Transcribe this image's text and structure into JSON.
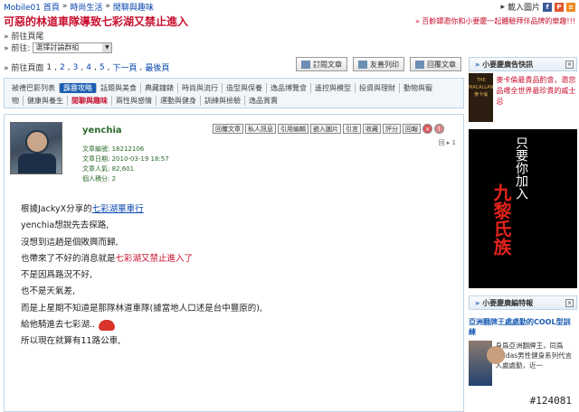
{
  "breadcrumb": [
    "Mobile01 首頁",
    "時尚生活",
    "閒聊與趣味"
  ],
  "breadcrumb_sep": "»",
  "top_right": {
    "label": "載入圖片",
    "arrow": "▸",
    "icons": [
      {
        "name": "facebook-icon",
        "glyph": "f",
        "color": "#3b5998"
      },
      {
        "name": "plurk-icon",
        "glyph": "P",
        "color": "#e2562c"
      },
      {
        "name": "rss-icon",
        "glyph": "≡",
        "color": "#f28a1f"
      }
    ]
  },
  "thread_title": "可惡的林道車隊導致七彩湖又禁止進入",
  "promo": "» 百齡罈邀你和小要慶一起體驗拜伴品牌的樂趣!!!",
  "goto_last": "» 前往頁尾",
  "forum_select": {
    "label": "» 前往:",
    "value": "選擇討論群組"
  },
  "pages": {
    "label": "» 前往頁面",
    "items": [
      "1",
      "2",
      "3",
      "4",
      "5"
    ],
    "next": "下一頁",
    "last": "最後頁"
  },
  "actions": [
    {
      "name": "subscribe-button",
      "label": "訂閱文章"
    },
    {
      "name": "print-button",
      "label": "友善列印"
    },
    {
      "name": "reply-button",
      "label": "回覆文章"
    }
  ],
  "tags_row1": [
    "被禮巴影列表",
    "霹靂攻略",
    "話題與美食",
    "典藏鐘錶",
    "時尚與流行",
    "造型與保養",
    "逸品博覽會",
    "遙控與模型",
    "投資與理財",
    "動物與寵"
  ],
  "tags_row2": [
    "物",
    "健康與養生",
    "閒聊與趣味",
    "兩性與感情",
    "運動與健身",
    "訓練與檢驗",
    "逸品賞賣"
  ],
  "post": {
    "username": "yenchia",
    "meta": [
      {
        "k": "文章編號:",
        "v": "18212106"
      },
      {
        "k": "文章日期:",
        "v": "2010-03-19 18:57"
      },
      {
        "k": "文章人氣:",
        "v": "82,601"
      },
      {
        "k": "個人積分:",
        "v": "2"
      }
    ],
    "tools": [
      "回覆文章",
      "私人訊息",
      "引用編輯",
      "嵌入圖片",
      "引言",
      "收藏",
      "評分",
      "回報"
    ],
    "floor": "回 ▸ 1",
    "lines": [
      {
        "pre": "根據JackyX分享的",
        "link": "七彩湖單車行",
        "post": ""
      },
      {
        "pre": "yenchia想說先去探路,",
        "link": "",
        "post": ""
      },
      {
        "pre": "沒想到這趟是個敗興而歸,",
        "link": "",
        "post": ""
      },
      {
        "pre": "也帶來了不好的消息就是",
        "red": "七彩湖又禁止進入了",
        "post": ""
      },
      {
        "pre": "不是因爲路況不好,",
        "link": "",
        "post": ""
      },
      {
        "pre": "也不是天氣差,",
        "link": "",
        "post": ""
      },
      {
        "pre": "而是上星期不知道是那隊林道車隊(據當地人口述是台中豐原的),",
        "link": "",
        "post": ""
      },
      {
        "pre": "給他騎進去七彩湖..",
        "link": "",
        "post": ""
      },
      {
        "pre": "所以現在就算有11路公車,",
        "link": "",
        "post": ""
      }
    ]
  },
  "sidebar": {
    "box1_title": "小要慶廣告快訊",
    "box1_arrow": "»",
    "box1_close": "×",
    "ad1_bottle": [
      "THE",
      "MACALLAN",
      "麥卡倫"
    ],
    "ad1_text": "麥卡倫最貴品酌會，邀您品嚐全世界最珍貴的威士忌",
    "ad2_white": "只要你加入",
    "ad2_red": "九黎氏族",
    "box2_title": "小要慶廣編特報",
    "news_title": "亞洲翻牌王處處勤的COOL型訓練",
    "news_text": "身爲亞洲翻牌王，同爲adidas男性健身系列代言人處處勤，近一"
  },
  "watermark": "#124081"
}
